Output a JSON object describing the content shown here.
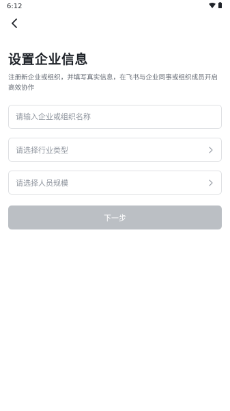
{
  "status_bar": {
    "time": "6:12",
    "wifi_icon": "wifi-icon",
    "battery_icon": "battery-icon"
  },
  "header": {
    "back_icon": "chevron-left-icon"
  },
  "page": {
    "title": "设置企业信息",
    "description": "注册新企业或组织，并填写真实信息，在飞书与企业同事或组织成员开启高效协作"
  },
  "form": {
    "org_name": {
      "placeholder": "请输入企业或组织名称",
      "value": ""
    },
    "industry": {
      "placeholder": "请选择行业类型",
      "icon": "chevron-right-icon"
    },
    "staff_size": {
      "placeholder": "请选择人员规模",
      "icon": "chevron-right-icon"
    },
    "next_label": "下一步"
  },
  "colors": {
    "title": "#1f2329",
    "description": "#646a73",
    "placeholder": "#8f959e",
    "border": "#dee0e3",
    "button_disabled": "#bbbfc4",
    "button_text": "#ffffff"
  }
}
